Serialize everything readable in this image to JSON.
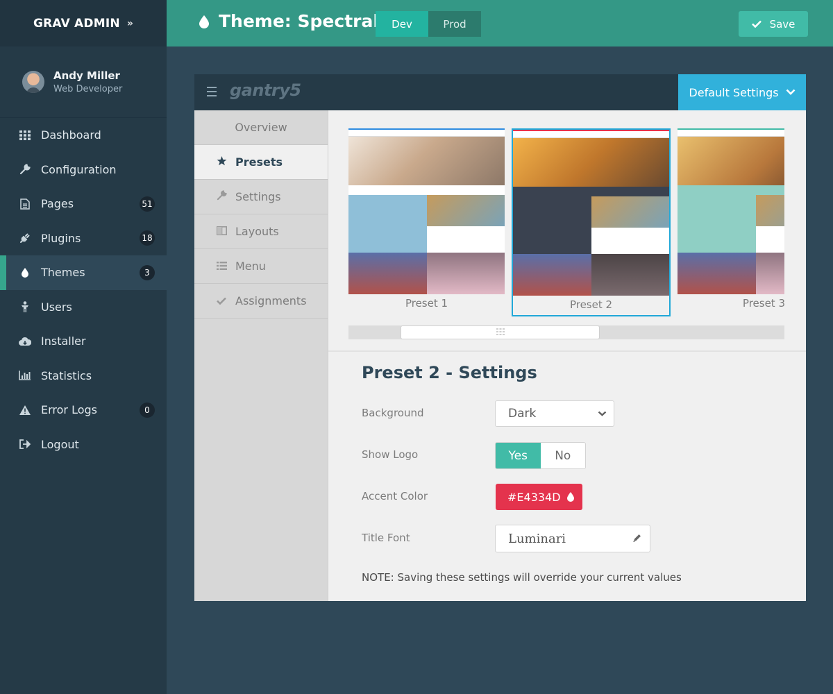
{
  "app": {
    "brand": "GRAV ADMIN",
    "brand_chevron": "»"
  },
  "profile": {
    "name": "Andy Miller",
    "role": "Web Developer"
  },
  "nav": [
    {
      "label": "Dashboard",
      "icon": "dashboard-icon",
      "badge": ""
    },
    {
      "label": "Configuration",
      "icon": "wrench-icon",
      "badge": ""
    },
    {
      "label": "Pages",
      "icon": "file-icon",
      "badge": "51"
    },
    {
      "label": "Plugins",
      "icon": "plug-icon",
      "badge": "18"
    },
    {
      "label": "Themes",
      "icon": "tint-icon",
      "badge": "3",
      "active": true
    },
    {
      "label": "Users",
      "icon": "user-icon",
      "badge": ""
    },
    {
      "label": "Installer",
      "icon": "cloud-download-icon",
      "badge": ""
    },
    {
      "label": "Statistics",
      "icon": "bar-chart-icon",
      "badge": ""
    },
    {
      "label": "Error Logs",
      "icon": "warning-icon",
      "badge": "0"
    },
    {
      "label": "Logout",
      "icon": "sign-out-icon",
      "badge": ""
    }
  ],
  "header": {
    "title": "Theme: Spectral",
    "env": {
      "dev": "Dev",
      "prod": "Prod",
      "active": "Dev"
    },
    "save_label": "Save"
  },
  "gantry": {
    "logo": "gantry5",
    "preset_select": "Default Settings",
    "menu": [
      {
        "label": "Overview",
        "icon": ""
      },
      {
        "label": "Presets",
        "icon": "star-icon",
        "active": true
      },
      {
        "label": "Settings",
        "icon": "wrench-icon"
      },
      {
        "label": "Layouts",
        "icon": "columns-icon"
      },
      {
        "label": "Menu",
        "icon": "list-icon"
      },
      {
        "label": "Assignments",
        "icon": "check-icon"
      }
    ],
    "presets": [
      {
        "label": "Preset 1",
        "accent": "#2f8ce0",
        "hero": "#d8b89a",
        "band": "#8fbfd8"
      },
      {
        "label": "Preset 2",
        "accent": "#e4334d",
        "hero": "#c0772c",
        "band": "#3a4250",
        "selected": true
      },
      {
        "label": "Preset 3",
        "accent": "#41bba7",
        "hero": "#d9a24a",
        "band": "#8fcfc4"
      }
    ],
    "settings": {
      "title": "Preset 2 - Settings",
      "background_label": "Background",
      "background_value": "Dark",
      "show_logo_label": "Show Logo",
      "show_logo_yes": "Yes",
      "show_logo_no": "No",
      "show_logo_value": "Yes",
      "accent_label": "Accent Color",
      "accent_value": "#E4334D",
      "title_font_label": "Title Font",
      "title_font_value": "Luminari",
      "note": "NOTE: Saving these settings will override your current values"
    }
  },
  "colors": {
    "sidebar": "#253a47",
    "topbar": "#349886",
    "accent_teal": "#41bba7",
    "select_blue": "#31b1db",
    "accent_red": "#e4334d"
  }
}
